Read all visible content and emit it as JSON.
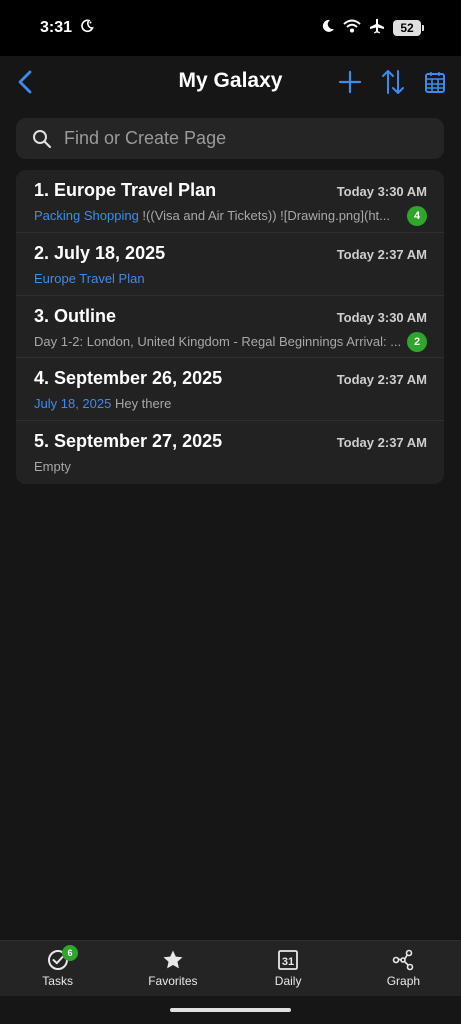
{
  "status_bar": {
    "time": "3:31",
    "battery": "52"
  },
  "header": {
    "title": "My Galaxy"
  },
  "search": {
    "placeholder": "Find or Create Page"
  },
  "pages": [
    {
      "title": "1. Europe Travel Plan",
      "time": "Today 3:30 AM",
      "link_text": "Packing Shopping",
      "preview": " !((Visa and Air Tickets)) ![Drawing.png](ht...",
      "badge": "4"
    },
    {
      "title": "2. July 18, 2025",
      "time": "Today 2:37 AM",
      "link_text": "Europe Travel Plan",
      "preview": ""
    },
    {
      "title": "3. Outline",
      "time": "Today 3:30 AM",
      "link_text": "",
      "preview": "Day 1-2: London, United Kingdom - Regal Beginnings Arrival: ...",
      "badge": "2"
    },
    {
      "title": "4. September 26, 2025",
      "time": "Today 2:37 AM",
      "link_text": "July 18, 2025",
      "preview": " Hey there"
    },
    {
      "title": "5. September 27, 2025",
      "time": "Today 2:37 AM",
      "link_text": "",
      "preview": "Empty"
    }
  ],
  "bottom_nav": {
    "tasks": "Tasks",
    "tasks_badge": "6",
    "favorites": "Favorites",
    "daily": "Daily",
    "daily_icon_text": "31",
    "graph": "Graph"
  },
  "colors": {
    "accent": "#3b8ded",
    "badge_green": "#2fa52c",
    "background": "#161616",
    "card": "#222222"
  }
}
